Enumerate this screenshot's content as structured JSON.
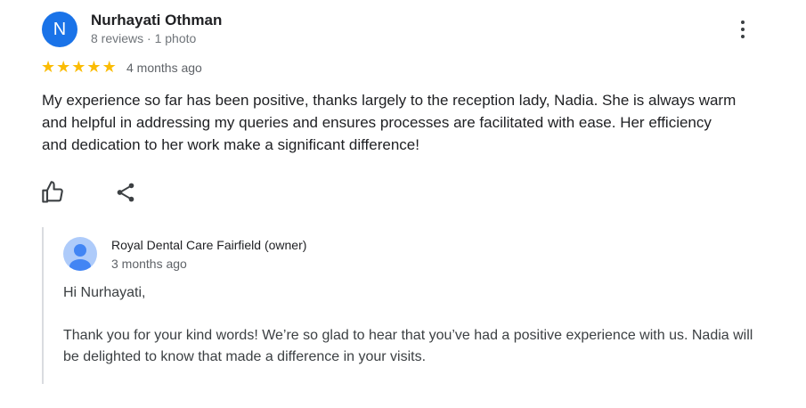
{
  "review": {
    "avatar_letter": "N",
    "reviewer_name": "Nurhayati Othman",
    "reviewer_meta": "8 reviews · 1 photo",
    "rating": 5,
    "date": "4 months ago",
    "text": "My experience so far has been positive, thanks largely to the reception lady, Nadia. She is always warm and helpful in addressing my queries and ensures processes are facilitated with ease. Her efficiency and dedication to her work make a significant difference!",
    "icons": {
      "more": "more-vert-icon",
      "like": "thumb-up-icon",
      "share": "share-icon"
    }
  },
  "owner_reply": {
    "owner_name": "Royal Dental Care Fairfield (owner)",
    "date": "3 months ago",
    "greeting": "Hi Nurhayati,",
    "body": "Thank you for your kind words! We’re so glad to hear that you’ve had a positive experience with us. Nadia will be delighted to know that made a difference in your visits."
  },
  "colors": {
    "avatar_bg": "#1a73e8",
    "star": "#fbbc04",
    "reply_border": "#dadce0"
  }
}
